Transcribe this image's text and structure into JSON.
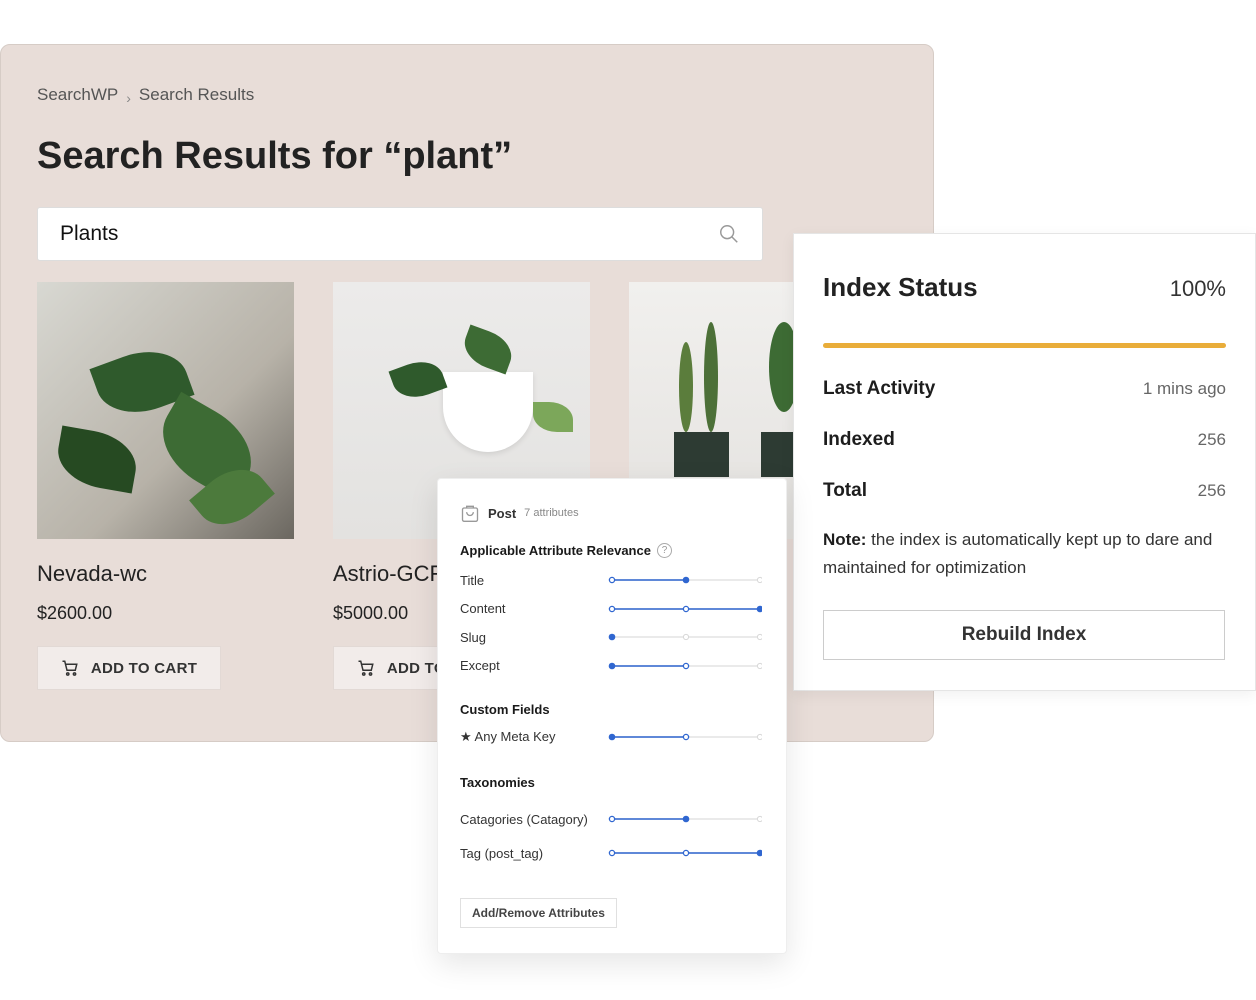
{
  "breadcrumb": {
    "items": [
      "SearchWP",
      "Search Results"
    ]
  },
  "page_title": "Search Results for “plant”",
  "search": {
    "value": "Plants",
    "icon": "search-icon"
  },
  "products": [
    {
      "name": "Nevada-wc",
      "price": "$2600.00",
      "button": "ADD TO CART"
    },
    {
      "name": "Astrio-GCF",
      "price": "$5000.00",
      "button": "ADD TO CART"
    },
    {
      "name": "",
      "price": "",
      "button": ""
    }
  ],
  "index_status": {
    "title": "Index Status",
    "percent_label": "100%",
    "progress": 100,
    "accent": "#e9ad3a",
    "rows": [
      {
        "label": "Last Activity",
        "value": "1 mins ago"
      },
      {
        "label": "Indexed",
        "value": "256"
      },
      {
        "label": "Total",
        "value": "256"
      }
    ],
    "note_label": "Note:",
    "note_text": " the index is automatically kept up to dare and maintained for optimization",
    "rebuild_label": "Rebuild Index"
  },
  "relevance": {
    "post_label": "Post",
    "attr_count": "7 attributes",
    "section_title": "Applicable Attribute Relevance",
    "accent": "#2f66d0",
    "attributes": [
      {
        "label": "Title",
        "dots": [
          "hollow",
          "filled",
          "off"
        ]
      },
      {
        "label": "Content",
        "dots": [
          "hollow",
          "hollow",
          "filled"
        ]
      },
      {
        "label": "Slug",
        "dots": [
          "filled",
          "off",
          "off"
        ]
      },
      {
        "label": "Except",
        "dots": [
          "filled",
          "hollow",
          "off"
        ]
      }
    ],
    "custom_fields_title": "Custom Fields",
    "custom_fields": [
      {
        "label": "★ Any Meta Key",
        "dots": [
          "filled",
          "hollow",
          "off"
        ]
      }
    ],
    "taxonomies_title": "Taxonomies",
    "taxonomies": [
      {
        "label": "Catagories (Catagory)",
        "dots": [
          "hollow",
          "filled",
          "off"
        ]
      },
      {
        "label": "Tag (post_tag)",
        "dots": [
          "hollow",
          "hollow",
          "filled"
        ]
      }
    ],
    "add_remove_label": "Add/Remove Attributes"
  }
}
